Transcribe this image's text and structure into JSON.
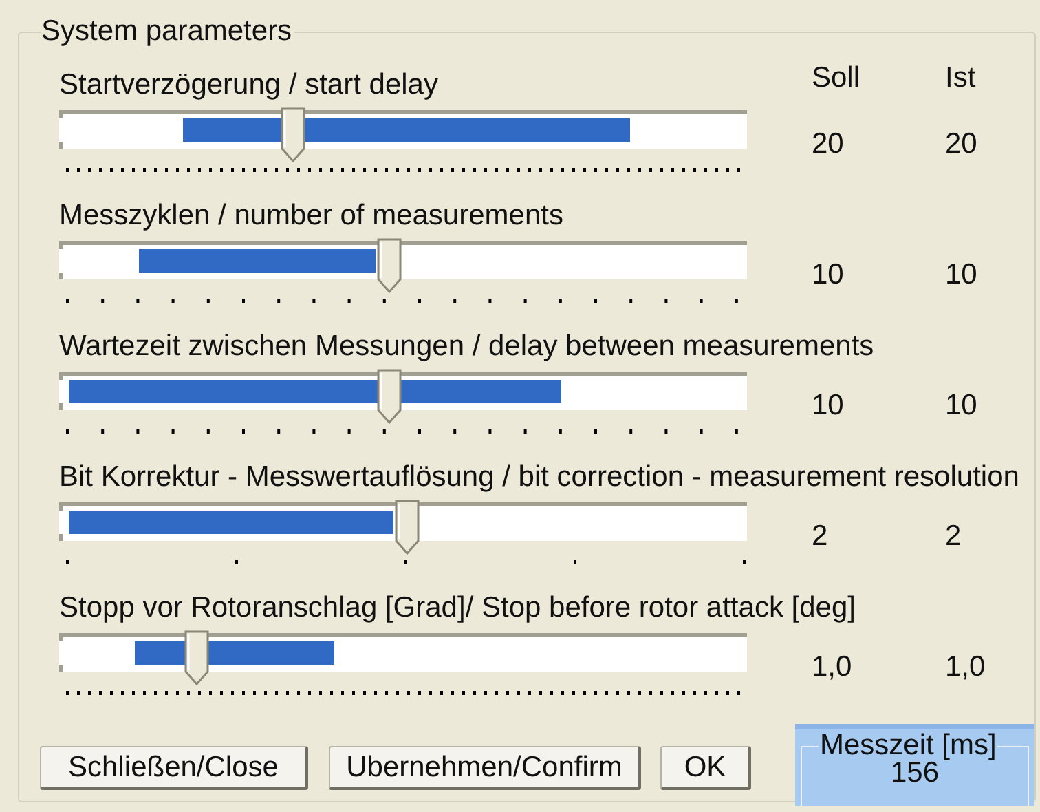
{
  "group_title": "System parameters",
  "column_headers": [
    "Soll",
    "Ist"
  ],
  "parameters": [
    {
      "label": "Startverzögerung / start delay",
      "kind": "fine",
      "level": 0.34,
      "selection": [
        {
          "level": 0.18
        },
        {
          "level": 0.83
        }
      ],
      "soll": "20",
      "ist": "20"
    },
    {
      "label": "Messzyklen / number of measurements",
      "kind": "coarse",
      "level": 0.48,
      "selection": [
        {
          "level": 0.115
        },
        {
          "level": 0.46
        }
      ],
      "soll": "10",
      "ist": "10"
    },
    {
      "label": "Wartezeit zwischen Messungen / delay between measurements",
      "kind": "coarse",
      "level": 0.48,
      "selection": [
        {
          "level": 0.014
        },
        {
          "level": 0.73
        }
      ],
      "soll": "10",
      "ist": "10"
    },
    {
      "label": "Bit Korrektur - Messwertauflösung / bit correction - measurement resolution",
      "kind": "sparse",
      "level": 0.505,
      "selection": [
        {
          "level": 0.014
        },
        {
          "level": 0.485
        }
      ],
      "soll": "2",
      "ist": "2"
    },
    {
      "label": "Stopp vor Rotoranschlag [Grad]/ Stop before rotor attack [deg]",
      "kind": "fine",
      "level": 0.2,
      "selection": [
        {
          "level": 0.11
        },
        {
          "level": 0.4
        }
      ],
      "soll": "1,0",
      "ist": "1,0"
    }
  ],
  "buttons": [
    "Schließen/Close",
    "Ubernehmen/Confirm",
    "OK"
  ],
  "measure_time": {
    "title": "Messzeit [ms]",
    "value": "156"
  }
}
